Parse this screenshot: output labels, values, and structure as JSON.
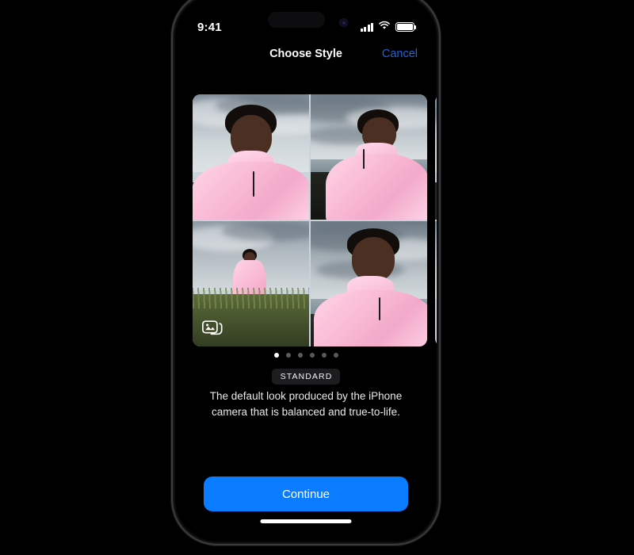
{
  "background_color": "#000000",
  "device": {
    "frame_color": "#3a3a3c",
    "screen_background": "#000000"
  },
  "status_bar": {
    "time": "9:41",
    "signal_icon": "cellular-bars-icon",
    "wifi_icon": "wifi-icon",
    "battery_icon": "battery-full-icon",
    "dynamic_island": "dynamic-island",
    "camera_dot": "front-camera-icon"
  },
  "nav_bar": {
    "title": "Choose Style",
    "cancel_label": "Cancel",
    "cancel_color": "#1f63d6"
  },
  "carousel": {
    "multi_photo_icon": "photo-stack-icon",
    "cards": [
      {
        "id": "standard",
        "photos": [
          "selfie-portrait-mountains",
          "side-profile-black-beach",
          "full-body-grass-mountain",
          "close-up-portrait-sea"
        ]
      },
      {
        "id": "next-style-peek",
        "photos": []
      }
    ]
  },
  "pagination": {
    "total": 6,
    "active_index": 0,
    "active_color": "#ffffff",
    "inactive_color": "#5b5b5e"
  },
  "style_info": {
    "badge": "STANDARD",
    "description": "The default look produced by the iPhone camera that is balanced and true-to-life."
  },
  "footer": {
    "continue_label": "Continue",
    "continue_color": "#0a7cff",
    "home_indicator": "home-indicator"
  }
}
